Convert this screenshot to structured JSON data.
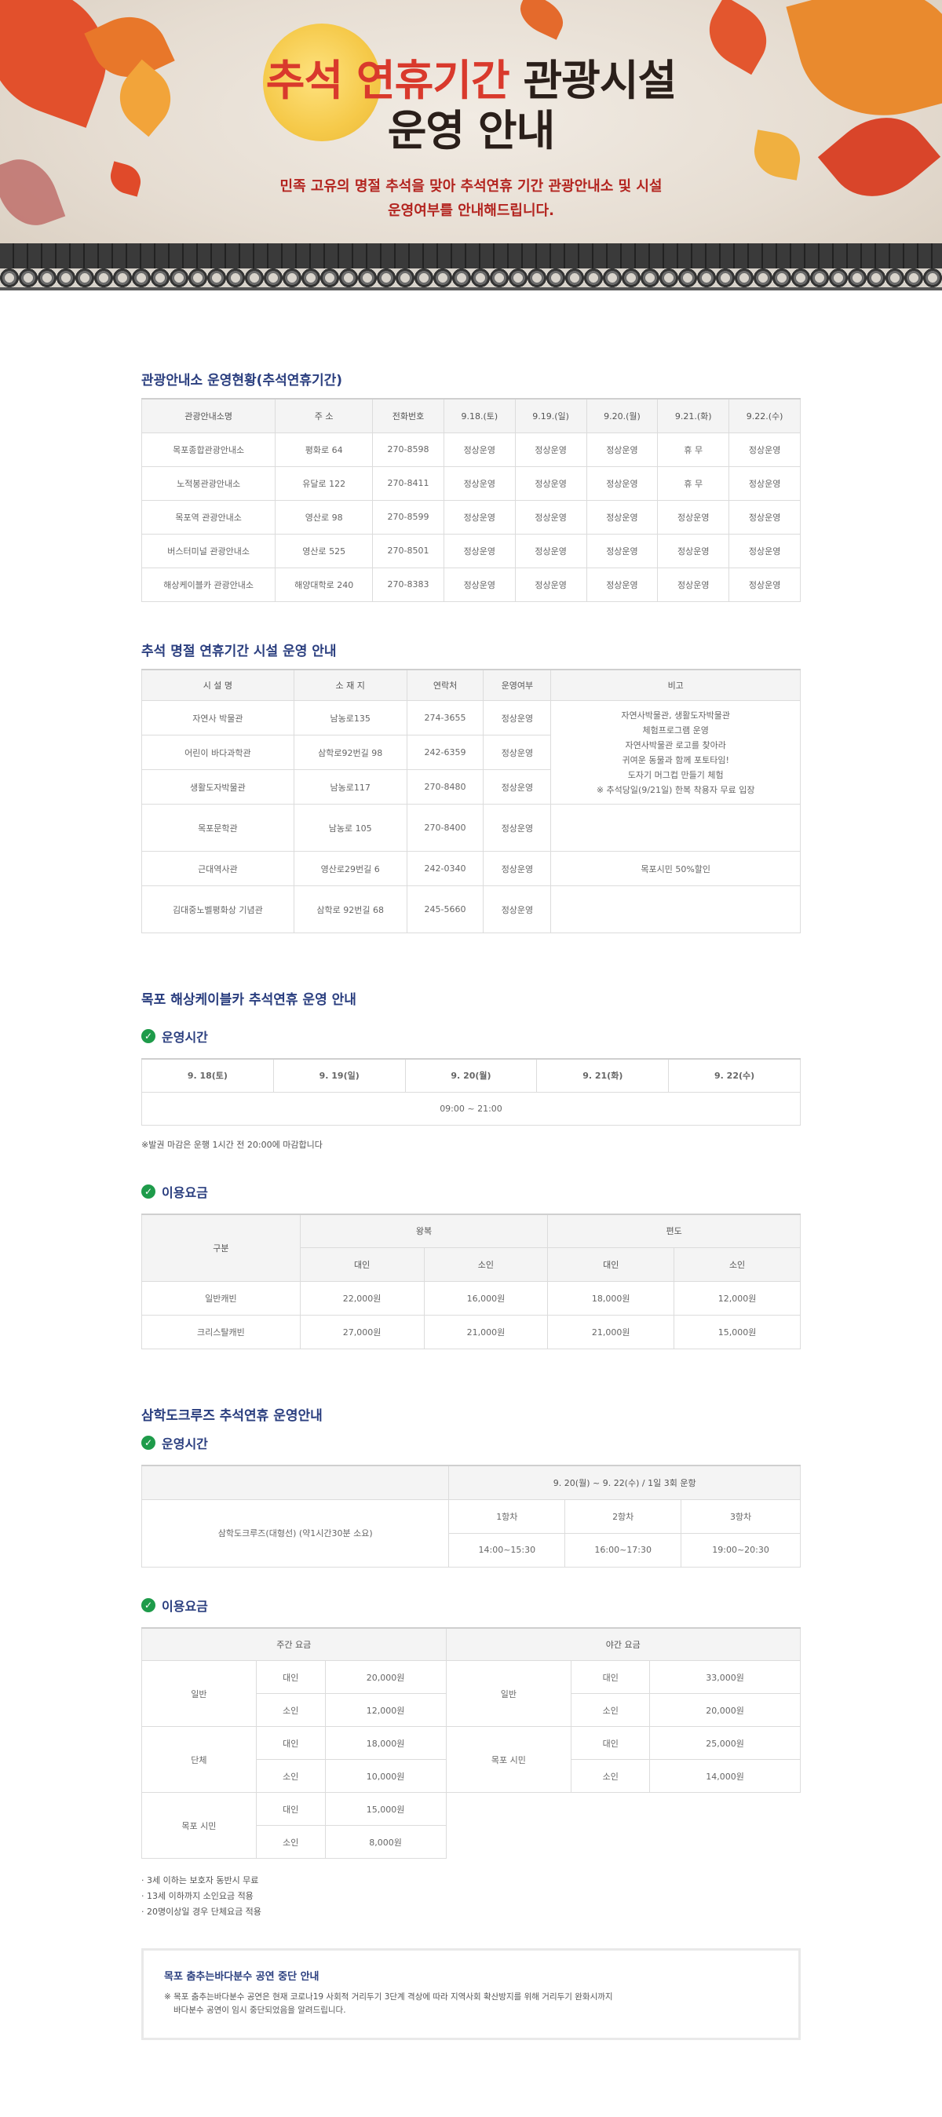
{
  "hero": {
    "title_red": "추석 연휴기간",
    "title_rest": " 관광시설",
    "title_line2": "운영 안내",
    "sub_line1": "민족 고유의 명절 추석을 맞아 추석연휴 기간 관광안내소 및 시설",
    "sub_line2": "운영여부를 안내해드립니다."
  },
  "info_centers": {
    "title": "관광안내소 운영현황(추석연휴기간)",
    "headers": [
      "관광안내소명",
      "주 소",
      "전화번호",
      "9.18.(토)",
      "9.19.(일)",
      "9.20.(월)",
      "9.21.(화)",
      "9.22.(수)"
    ],
    "rows": [
      [
        "목포종합관광안내소",
        "평화로 64",
        "270-8598",
        "정상운영",
        "정상운영",
        "정상운영",
        "휴 무",
        "정상운영"
      ],
      [
        "노적봉관광안내소",
        "유달로 122",
        "270-8411",
        "정상운영",
        "정상운영",
        "정상운영",
        "휴 무",
        "정상운영"
      ],
      [
        "목포역 관광안내소",
        "영산로 98",
        "270-8599",
        "정상운영",
        "정상운영",
        "정상운영",
        "정상운영",
        "정상운영"
      ],
      [
        "버스터미널 관광안내소",
        "영산로 525",
        "270-8501",
        "정상운영",
        "정상운영",
        "정상운영",
        "정상운영",
        "정상운영"
      ],
      [
        "해상케이블카 관광안내소",
        "해양대학로 240",
        "270-8383",
        "정상운영",
        "정상운영",
        "정상운영",
        "정상운영",
        "정상운영"
      ]
    ]
  },
  "facilities": {
    "title": "추석 명절 연휴기간 시설 운영 안내",
    "headers": [
      "시 설 명",
      "소 재 지",
      "연락처",
      "운영여부",
      "비고"
    ],
    "rows": [
      [
        "자연사 박물관",
        "남농로135",
        "274-3655",
        "정상운영"
      ],
      [
        "어린이 바다과학관",
        "삼학로92번길 98",
        "242-6359",
        "정상운영"
      ],
      [
        "생활도자박물관",
        "남농로117",
        "270-8480",
        "정상운영"
      ],
      [
        "목포문학관",
        "남농로 105",
        "270-8400",
        "정상운영"
      ],
      [
        "근대역사관",
        "영산로29번길 6",
        "242-0340",
        "정상운영"
      ],
      [
        "김대중노벨평화상 기념관",
        "삼학로 92번길 68",
        "245-5660",
        "정상운영"
      ]
    ],
    "note_group": [
      "자연사박물관, 생활도자박물관",
      "체험프로그램 운영",
      "자연사박물관 로고를 찾아라",
      "귀여운 동물과 함께 포토타임!",
      "도자기 머그컵 만들기 체험",
      "※ 추석당일(9/21일) 한복 착용자 무료 입장"
    ],
    "note_history": "목포시민 50%할인"
  },
  "cablecar": {
    "title": "목포 해상케이블카 추석연휴 운영 안내",
    "hours_title": "운영시간",
    "days": [
      "9. 18(토)",
      "9. 19(일)",
      "9. 20(월)",
      "9. 21(화)",
      "9. 22(수)"
    ],
    "hours": "09:00 ~ 21:00",
    "note": "※발권 마감은 운행 1시간 전 20:00에 마감합니다",
    "fee_title": "이용요금",
    "fee_headers": {
      "category": "구분",
      "round": "왕복",
      "oneway": "편도",
      "adult": "대인",
      "child": "소인"
    },
    "fee_rows": [
      [
        "일반캐빈",
        "22,000원",
        "16,000원",
        "18,000원",
        "12,000원"
      ],
      [
        "크리스탈캐빈",
        "27,000원",
        "21,000원",
        "21,000원",
        "15,000원"
      ]
    ]
  },
  "cruise": {
    "title": "삼학도크루즈 추석연휴 운영안내",
    "hours_title": "운영시간",
    "period": "9. 20(월) ~ 9. 22(수) / 1일 3회 운항",
    "ship": "삼학도크루즈(대형선) (약1시간30분 소요)",
    "rounds": [
      "1항차",
      "2항차",
      "3항차"
    ],
    "times": [
      "14:00~15:30",
      "16:00~17:30",
      "19:00~20:30"
    ],
    "fee_title": "이용요금",
    "day_fee": "주간 요금",
    "night_fee": "야간 요금",
    "labels": {
      "general": "일반",
      "group": "단체",
      "citizen": "목포 시민",
      "adult": "대인",
      "child": "소인"
    },
    "day": {
      "general_adult": "20,000원",
      "general_child": "12,000원",
      "group_adult": "18,000원",
      "group_child": "10,000원",
      "citizen_adult": "15,000원",
      "citizen_child": "8,000원"
    },
    "night": {
      "general_adult": "33,000원",
      "general_child": "20,000원",
      "citizen_adult": "25,000원",
      "citizen_child": "14,000원"
    },
    "bullets": [
      "3세 이하는 보호자 동반시 무료",
      "13세 이하까지 소인요금 적용",
      "20명이상일 경우 단체요금 적용"
    ]
  },
  "notice": {
    "title": "목포 춤추는바다분수 공연 중단 안내",
    "body_line1": "※ 목포 춤추는바다분수 공연은 현재 코로나19 사회적 거리두기 3단계 격상에 따라 지역사회 확산방지를 위해 거리두기 완화시까지",
    "body_line2": "바다분수 공연이 임시 중단되었음을 알려드립니다."
  }
}
